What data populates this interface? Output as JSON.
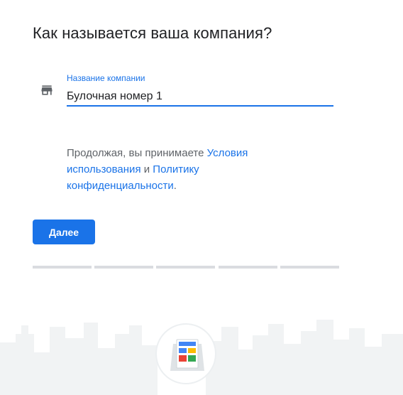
{
  "page": {
    "title": "Как называется ваша компания?"
  },
  "business_name_field": {
    "label": "Название компании",
    "value": "Булочная номер 1",
    "icon": "store-icon"
  },
  "terms": {
    "prefix": "Продолжая, вы принимаете ",
    "terms_link": "Условия использования",
    "conjunction": " и ",
    "privacy_link": "Политику конфиденциальности",
    "suffix": "."
  },
  "next_button": {
    "label": "Далее"
  },
  "progress": {
    "total_steps": 5
  },
  "illustration": {
    "icon": "storefront-sign-icon"
  },
  "colors": {
    "accent": "#1a73e8",
    "text_primary": "#202124",
    "text_secondary": "#5f6368",
    "progress_track": "#dadce0"
  }
}
